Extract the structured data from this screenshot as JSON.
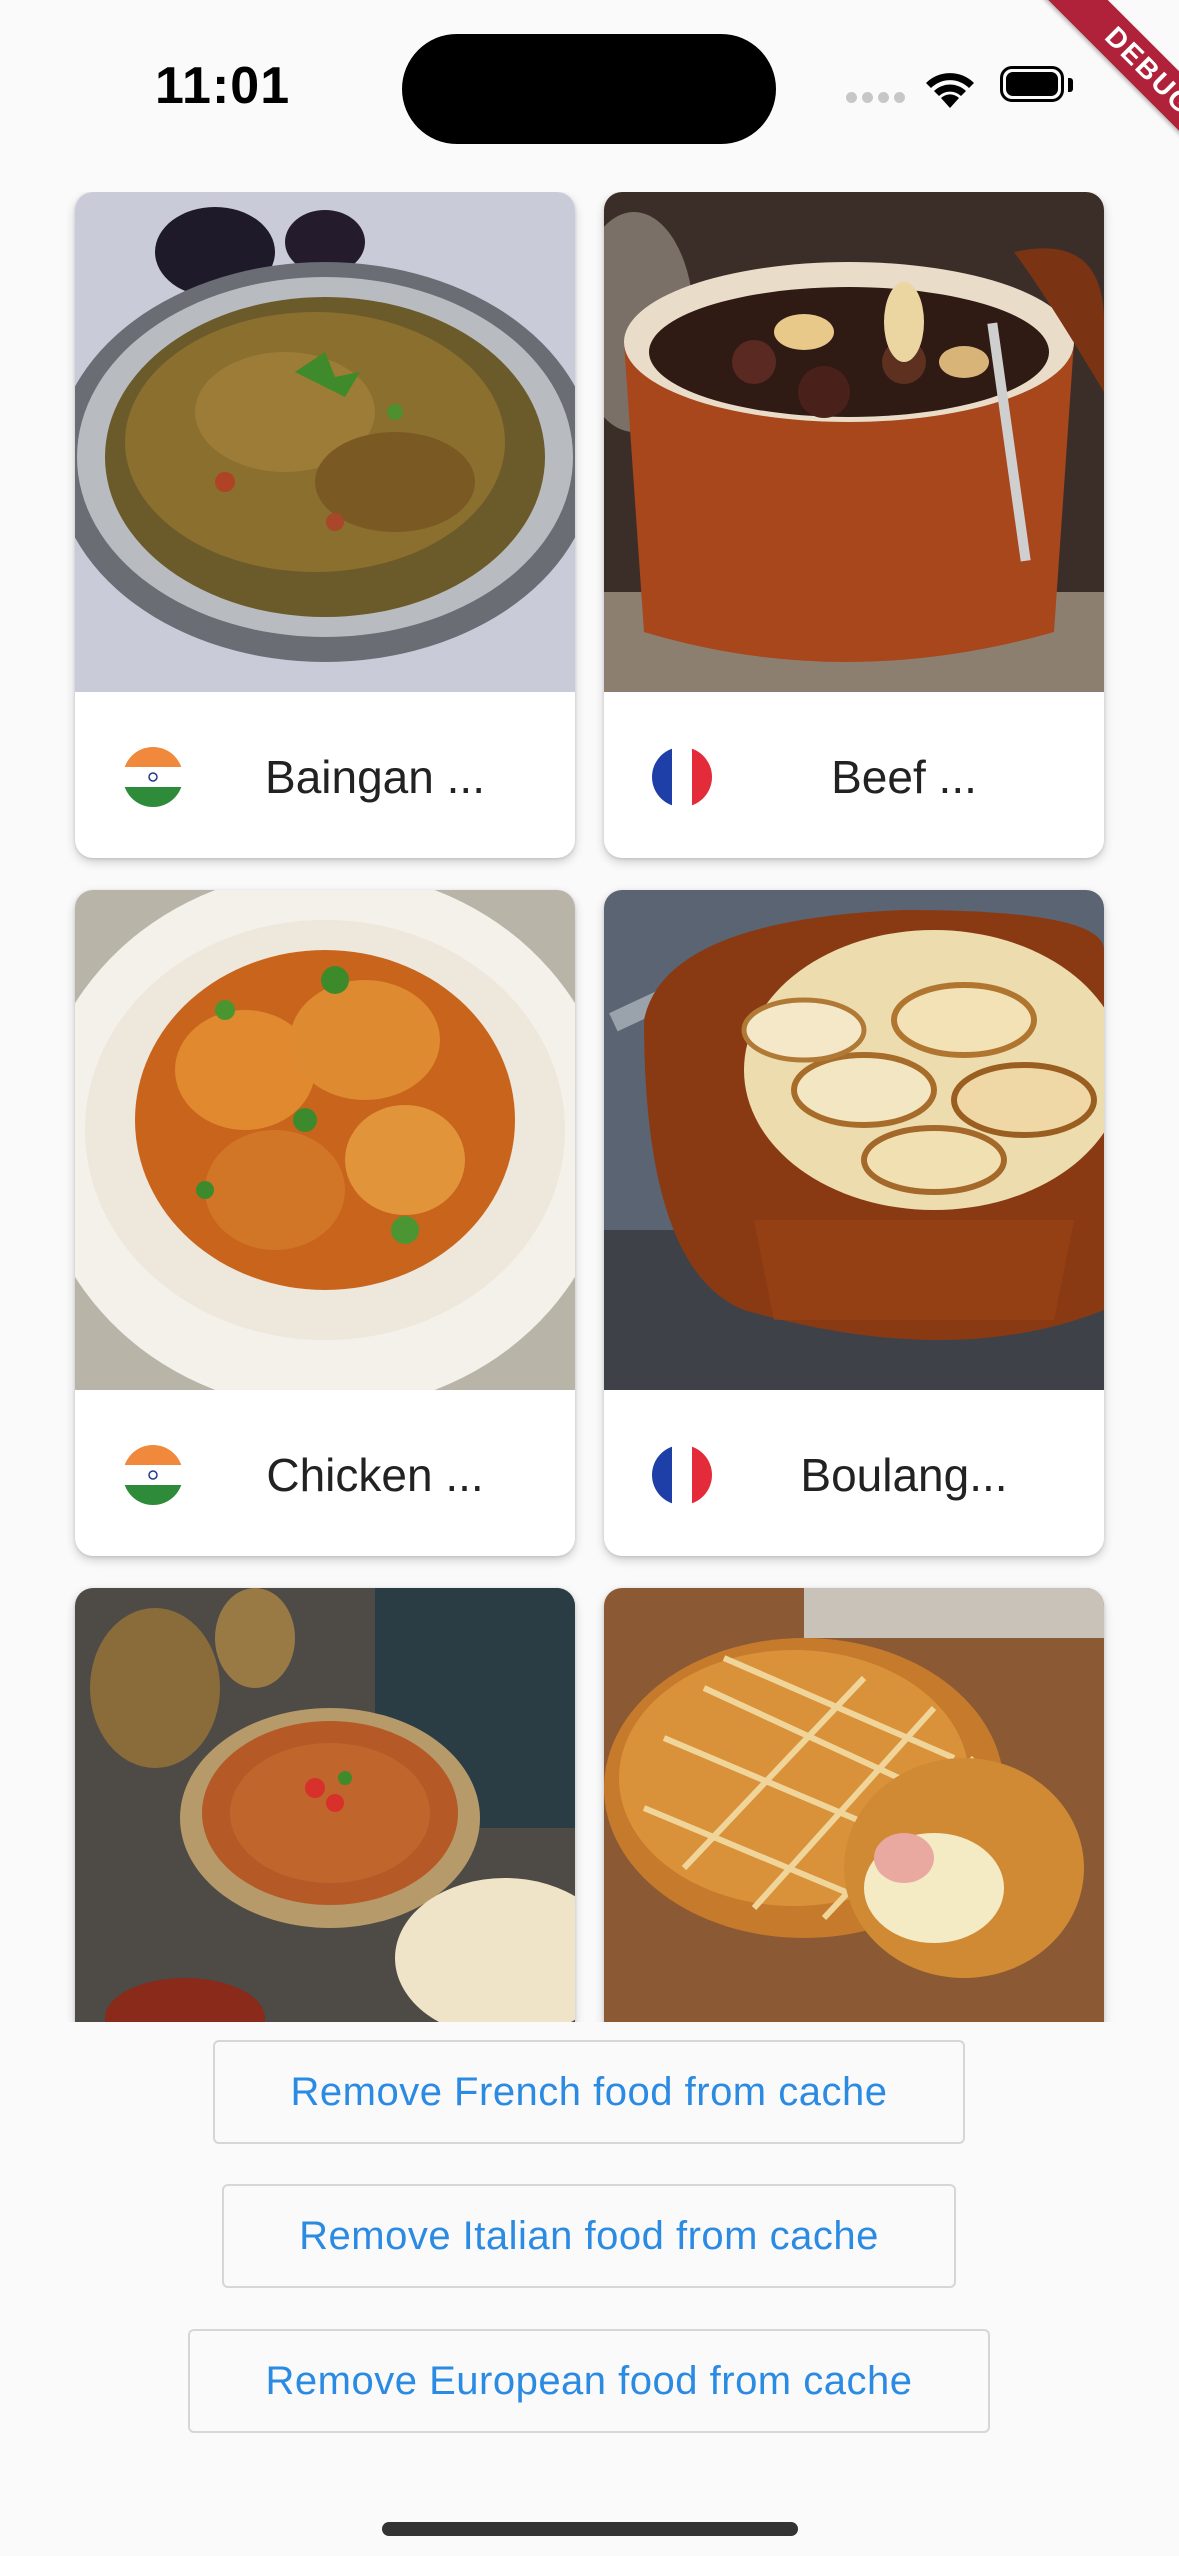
{
  "status_bar": {
    "time": "11:01",
    "debug_label": "DEBUG",
    "icons": [
      "signal-icon",
      "wifi-icon",
      "battery-icon"
    ]
  },
  "recipes": [
    {
      "title": "Baingan ...",
      "flag": "india-flag-icon",
      "image": "baingan-photo"
    },
    {
      "title": "Beef ...",
      "flag": "france-flag-icon",
      "image": "beef-photo"
    },
    {
      "title": "Chicken ...",
      "flag": "india-flag-icon",
      "image": "chicken-curry-photo"
    },
    {
      "title": "Boulang...",
      "flag": "france-flag-icon",
      "image": "boulangere-potatoes-photo"
    },
    {
      "title": "",
      "flag": "",
      "image": "dal-soup-photo"
    },
    {
      "title": "",
      "flag": "",
      "image": "pastry-pie-photo"
    }
  ],
  "actions": {
    "remove_french": "Remove French food from cache",
    "remove_italian": "Remove Italian food from cache",
    "remove_european": "Remove European food from cache"
  },
  "colors": {
    "accent": "#2b8ae2",
    "background": "#fafafa",
    "debug_banner": "#b0213a"
  }
}
